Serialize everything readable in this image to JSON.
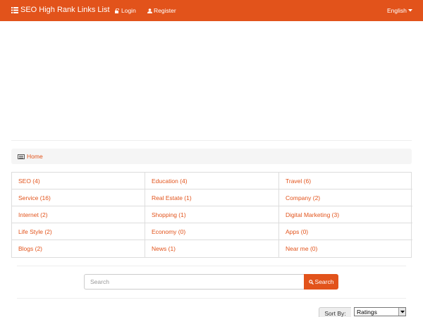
{
  "navbar": {
    "brand_label": "SEO High Rank Links List",
    "brand_icon": "list-icon",
    "login_label": "Login",
    "register_label": "Register",
    "language_label": "English",
    "background_color": "#e2531b"
  },
  "breadcrumb": {
    "home_label": "Home",
    "home_icon": "list-alt-icon"
  },
  "categories": [
    {
      "label": "SEO (4)"
    },
    {
      "label": "Education (4)"
    },
    {
      "label": "Travel (6)"
    },
    {
      "label": "Service (16)"
    },
    {
      "label": "Real Estate (1)"
    },
    {
      "label": "Company (2)"
    },
    {
      "label": "Internet (2)"
    },
    {
      "label": "Shopping (1)"
    },
    {
      "label": "Digital Marketing (3)"
    },
    {
      "label": "Life Style (2)"
    },
    {
      "label": "Economy (0)"
    },
    {
      "label": "Apps (0)"
    },
    {
      "label": "Blogs (2)"
    },
    {
      "label": "News (1)"
    },
    {
      "label": "Near me (0)"
    }
  ],
  "search": {
    "placeholder": "Search",
    "button_label": "Search"
  },
  "sort": {
    "label": "Sort By:",
    "selected": "Ratings"
  },
  "accent_color": "#e2531b"
}
